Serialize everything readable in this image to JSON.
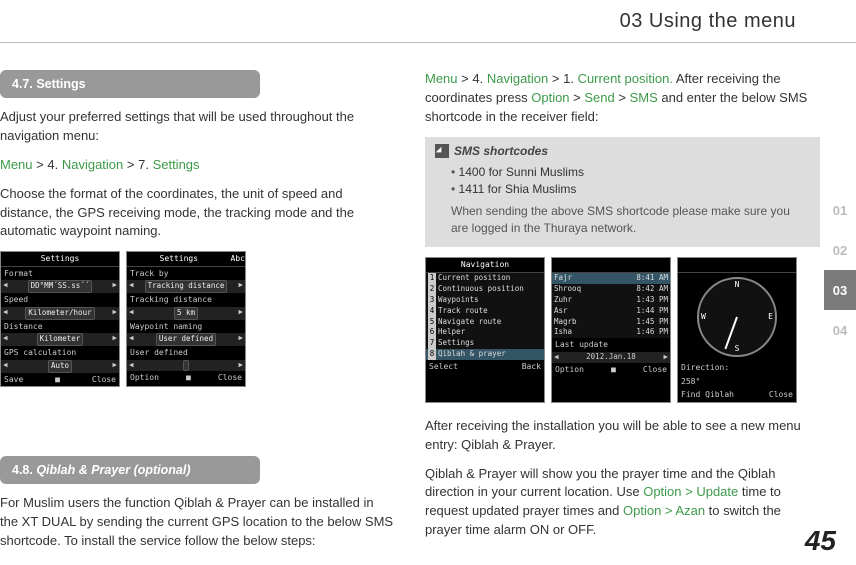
{
  "header": {
    "title": "03 Using the menu"
  },
  "side_tabs": [
    "01",
    "02",
    "03",
    "04"
  ],
  "active_tab": "03",
  "page_number": "45",
  "left": {
    "sec47": {
      "title": "4.7. Settings"
    },
    "p1a": "Adjust your preferred settings that will be used throughout the navigation menu:",
    "path47": {
      "menu": "Menu",
      "sep": " > ",
      "four": "4. ",
      "nav": "Navigation",
      "seven": "7. ",
      "settings": "Settings"
    },
    "p1b": "Choose the format of the coordinates, the unit of speed and distance, the GPS receiving mode, the tracking mode and the automatic waypoint naming.",
    "phone1": {
      "title": "Settings",
      "rows": [
        {
          "label": "Format",
          "val": "DD°MM´SS.ss´´"
        },
        {
          "label": "Speed",
          "val": "Kilometer/hour"
        },
        {
          "label": "Distance",
          "val": "Kilometer"
        },
        {
          "label": "GPS calculation",
          "val": "Auto"
        }
      ],
      "soft_l": "Save",
      "soft_r": "Close"
    },
    "phone2": {
      "title": "Settings",
      "top_r": "Abc",
      "rows": [
        {
          "label": "Track by",
          "val": "Tracking distance"
        },
        {
          "label": "Tracking distance",
          "val": "5 km"
        },
        {
          "label": "Waypoint naming",
          "val": "User defined"
        },
        {
          "label": "User defined",
          "val": ""
        }
      ],
      "soft_l": "Option",
      "soft_r": "Close"
    },
    "sec48": {
      "title_a": "4.8. ",
      "title_b": "Qiblah & Prayer (optional)"
    },
    "p48": "For Muslim users the function Qiblah & Prayer can be installed in the XT DUAL by sending the current GPS location to the below SMS shortcode. To install the service follow the below steps:"
  },
  "right": {
    "path_cp": {
      "menu": "Menu",
      "four": "4. ",
      "nav": "Navigation",
      "one": "1. ",
      "cp": "Current position."
    },
    "p_cp_a": " After receiving the coordinates press ",
    "opt": "Option",
    "send": "Send",
    "sms": "SMS",
    "p_cp_b": " and enter the below SMS shortcode in the receiver field:",
    "smsbox": {
      "title": "SMS shortcodes",
      "items": [
        "1400 for Sunni Muslims",
        "1411 for Shia Muslims"
      ],
      "note": "When sending the above SMS shortcode please make sure you are logged in the Thuraya network."
    },
    "phone_nav": {
      "title": "Navigation",
      "items": [
        "Current position",
        "Continuous position",
        "Waypoints",
        "Track route",
        "Navigate route",
        "Helper",
        "Settings",
        "Qiblah & prayer"
      ],
      "soft_l": "Select",
      "soft_r": "Back"
    },
    "phone_times": {
      "rows": [
        {
          "n": "Fajr",
          "t": "8:41 AM"
        },
        {
          "n": "Shrooq",
          "t": "8:42 AM"
        },
        {
          "n": "Zuhr",
          "t": "1:43 PM"
        },
        {
          "n": "Asr",
          "t": "1:44 PM"
        },
        {
          "n": "Magrb",
          "t": "1:45 PM"
        },
        {
          "n": "Isha",
          "t": "1:46 PM"
        }
      ],
      "last": "Last update",
      "date": "2012.Jan.18",
      "soft_l": "Option",
      "soft_r": "Close"
    },
    "phone_compass": {
      "dir": "Direction:",
      "deg": "258°",
      "soft_l": "Find Qiblah",
      "soft_r": "Close",
      "n": "N",
      "s": "S",
      "e": "E",
      "w": "W"
    },
    "p_after": "After receiving the installation you will be able to see a new menu entry: Qiblah & Prayer.",
    "p_last_a": "Qiblah & Prayer will show you the prayer time and the Qiblah direction in your current location. Use ",
    "opt_update": "Option > Update",
    "p_last_b": " time to request updated prayer times and ",
    "opt_azan": "Option > Azan",
    "p_last_c": " to switch the prayer time alarm ON or OFF."
  }
}
